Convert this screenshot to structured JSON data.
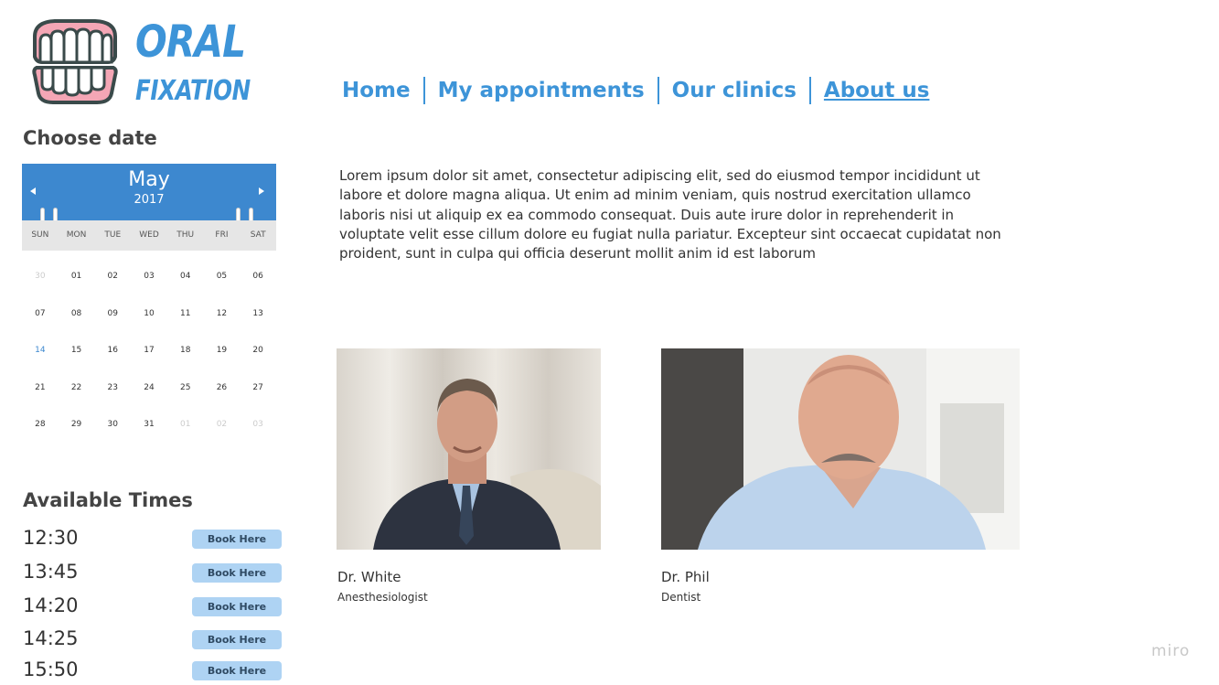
{
  "brand": {
    "name_line1": "ORAL",
    "name_line2": "FIXATION",
    "color": "#3d94d8",
    "gum_color": "#f4a6b5"
  },
  "nav": {
    "items": [
      {
        "label": "Home",
        "active": false
      },
      {
        "label": "My appointments",
        "active": false
      },
      {
        "label": "Our clinics",
        "active": false
      },
      {
        "label": "About us",
        "active": true
      }
    ]
  },
  "date_section": {
    "title": "Choose date"
  },
  "calendar": {
    "month": "May",
    "year": "2017",
    "days_of_week": [
      "SUN",
      "MON",
      "TUE",
      "WED",
      "THU",
      "FRI",
      "SAT"
    ],
    "weeks": [
      [
        "30",
        "01",
        "02",
        "03",
        "04",
        "05",
        "06"
      ],
      [
        "07",
        "08",
        "09",
        "10",
        "11",
        "12",
        "13"
      ],
      [
        "14",
        "15",
        "16",
        "17",
        "18",
        "19",
        "20"
      ],
      [
        "21",
        "22",
        "23",
        "24",
        "25",
        "26",
        "27"
      ],
      [
        "28",
        "29",
        "30",
        "31",
        "01",
        "02",
        "03"
      ]
    ],
    "header_color": "#3d88cf"
  },
  "times_section": {
    "title": "Available Times",
    "book_label": "Book Here",
    "times": [
      "12:30",
      "13:45",
      "14:20",
      "14:25",
      "15:50"
    ]
  },
  "intro": {
    "text": "Lorem ipsum dolor sit amet, consectetur adipiscing elit, sed do eiusmod tempor incididunt ut labore et dolore magna aliqua. Ut enim ad minim veniam, quis nostrud exercitation ullamco laboris nisi ut aliquip ex ea commodo consequat. Duis aute irure dolor in reprehenderit in voluptate velit esse cillum dolore eu fugiat nulla pariatur. Excepteur sint occaecat cupidatat non proident, sunt in culpa qui officia deserunt mollit anim id est laborum"
  },
  "doctors": [
    {
      "name": "Dr. White",
      "role": "Anesthesiologist"
    },
    {
      "name": "Dr. Phil",
      "role": "Dentist"
    }
  ],
  "watermark": "miro"
}
